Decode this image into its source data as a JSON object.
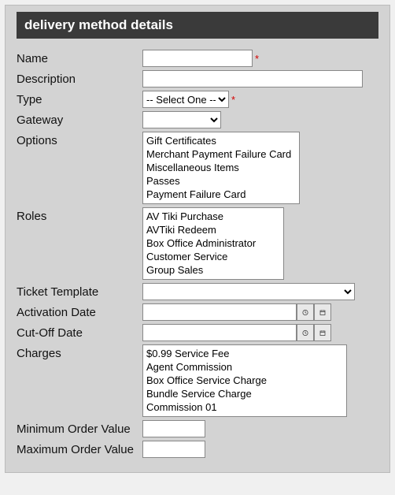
{
  "header": "delivery method details",
  "labels": {
    "name": "Name",
    "description": "Description",
    "type": "Type",
    "gateway": "Gateway",
    "options": "Options",
    "roles": "Roles",
    "ticket_template": "Ticket Template",
    "activation_date": "Activation Date",
    "cutoff_date": "Cut-Off Date",
    "charges": "Charges",
    "min_order": "Minimum Order Value",
    "max_order": "Maximum Order Value"
  },
  "required_marker": "*",
  "values": {
    "name": "",
    "description": "",
    "type": "-- Select One --",
    "gateway": "",
    "ticket_template": "",
    "activation_date": "",
    "cutoff_date": "",
    "min_order": "",
    "max_order": ""
  },
  "options_list": [
    "Gift Certificates",
    "Merchant Payment Failure Card",
    "Miscellaneous Items",
    "Passes",
    "Payment Failure Card"
  ],
  "roles_list": [
    "AV Tiki Purchase",
    "AVTiki Redeem",
    "Box Office Administrator",
    "Customer Service",
    "Group Sales"
  ],
  "charges_list": [
    "$0.99 Service Fee",
    "Agent Commission",
    "Box Office Service Charge",
    "Bundle Service Charge",
    "Commission 01"
  ]
}
